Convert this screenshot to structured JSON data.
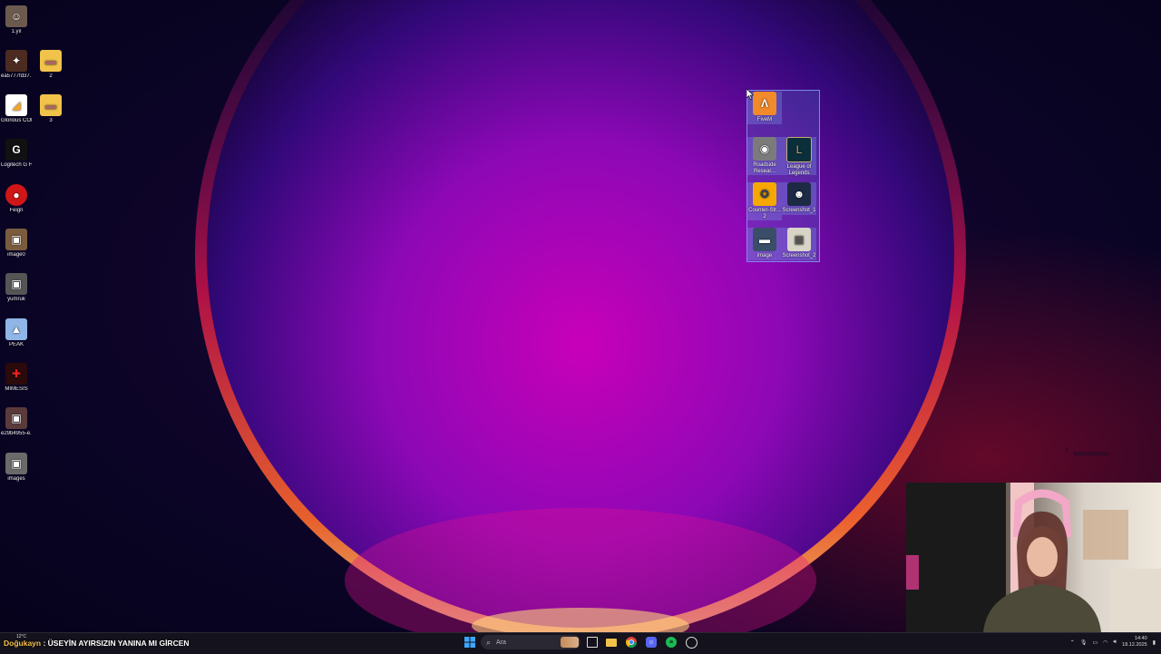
{
  "desktop_icons": [
    {
      "label": "1.yıl",
      "icon": "photo-icon"
    },
    {
      "label": "ea5777fd37...",
      "icon": "photo-icon"
    },
    {
      "label": "2",
      "icon": "folder-icon"
    },
    {
      "label": "Glorious CORE",
      "icon": "app-icon"
    },
    {
      "label": "3",
      "icon": "folder-icon"
    },
    {
      "label": "Logitech G HUB",
      "icon": "logitech-icon"
    },
    {
      "label": "Feign",
      "icon": "app-icon"
    },
    {
      "label": "image0",
      "icon": "photo-icon"
    },
    {
      "label": "yumruk",
      "icon": "photo-icon"
    },
    {
      "label": "PEAK",
      "icon": "game-icon"
    },
    {
      "label": "MIMESIS",
      "icon": "game-icon"
    },
    {
      "label": "e29b4955-e...",
      "icon": "photo-icon"
    },
    {
      "label": "images",
      "icon": "photo-icon"
    }
  ],
  "selected_icons": [
    {
      "label": "FiveM",
      "icon": "fivem-icon"
    },
    {
      "label": "Roadside Resear...",
      "icon": "game-icon"
    },
    {
      "label": "League of Legends",
      "icon": "league-icon"
    },
    {
      "label": "Counter-Str... 2",
      "icon": "cs2-icon"
    },
    {
      "label": "Screenshot_1",
      "icon": "photo-icon"
    },
    {
      "label": "image",
      "icon": "photo-icon"
    },
    {
      "label": "Screenshot_2",
      "icon": "photo-icon"
    }
  ],
  "ticker": {
    "user": "Doğukayn",
    "separator": " : ",
    "message": "ÜSEYİN AYIRSIZIN YANINA MI GİRCEN"
  },
  "weather": {
    "temp": "12°C"
  },
  "taskbar": {
    "search_placeholder": "Ara",
    "apps": [
      "start-icon",
      "widget-icon",
      "task-view-icon",
      "file-explorer-icon",
      "chrome-icon",
      "discord-icon",
      "spotify-icon",
      "obs-icon"
    ]
  },
  "clock": {
    "time": "14:40",
    "date": "18.12.2025"
  },
  "colors": {
    "wallpaper_core": "#b100b8",
    "wallpaper_rim": "#ff5a3c",
    "taskbar": "#14121c",
    "selection": "#5a78c8"
  }
}
